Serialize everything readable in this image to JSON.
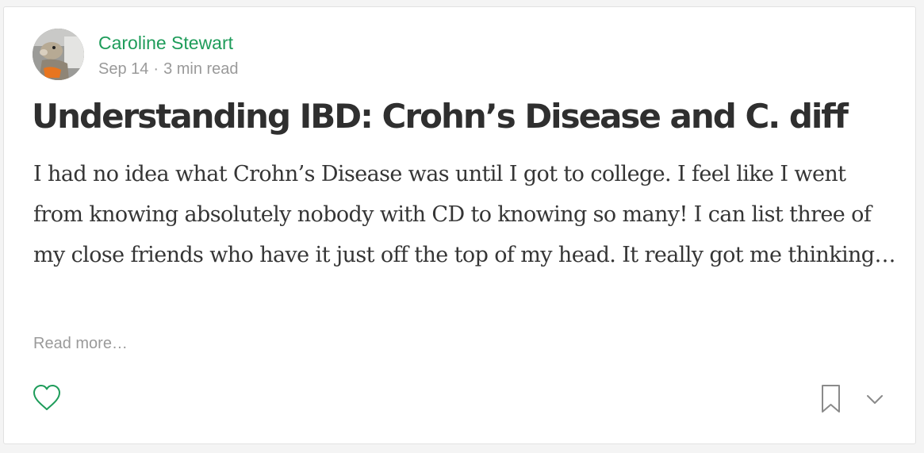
{
  "post": {
    "author": {
      "name": "Caroline Stewart",
      "avatar_icon": "user-avatar-photo"
    },
    "meta": {
      "date": "Sep 14",
      "separator": "·",
      "read_time": "3 min read"
    },
    "title": "Understanding IBD: Crohn’s Disease and C. diff",
    "excerpt": "I had no idea what Crohn’s Disease was until I got to college. I feel like I went from knowing absolutely nobody with CD to knowing so many! I can list three of my close friends who have it just off the top of my head. It really got me thinking…",
    "read_more_label": "Read more…"
  },
  "actions": {
    "like_icon": "heart-outline-icon",
    "bookmark_icon": "bookmark-outline-icon",
    "more_icon": "chevron-down-icon"
  },
  "colors": {
    "accent": "#1e9c5a",
    "muted_text": "#9a9a9a",
    "title_text": "#2f2f2f",
    "body_text": "#353535",
    "icon_gray": "#8a8a8a"
  }
}
